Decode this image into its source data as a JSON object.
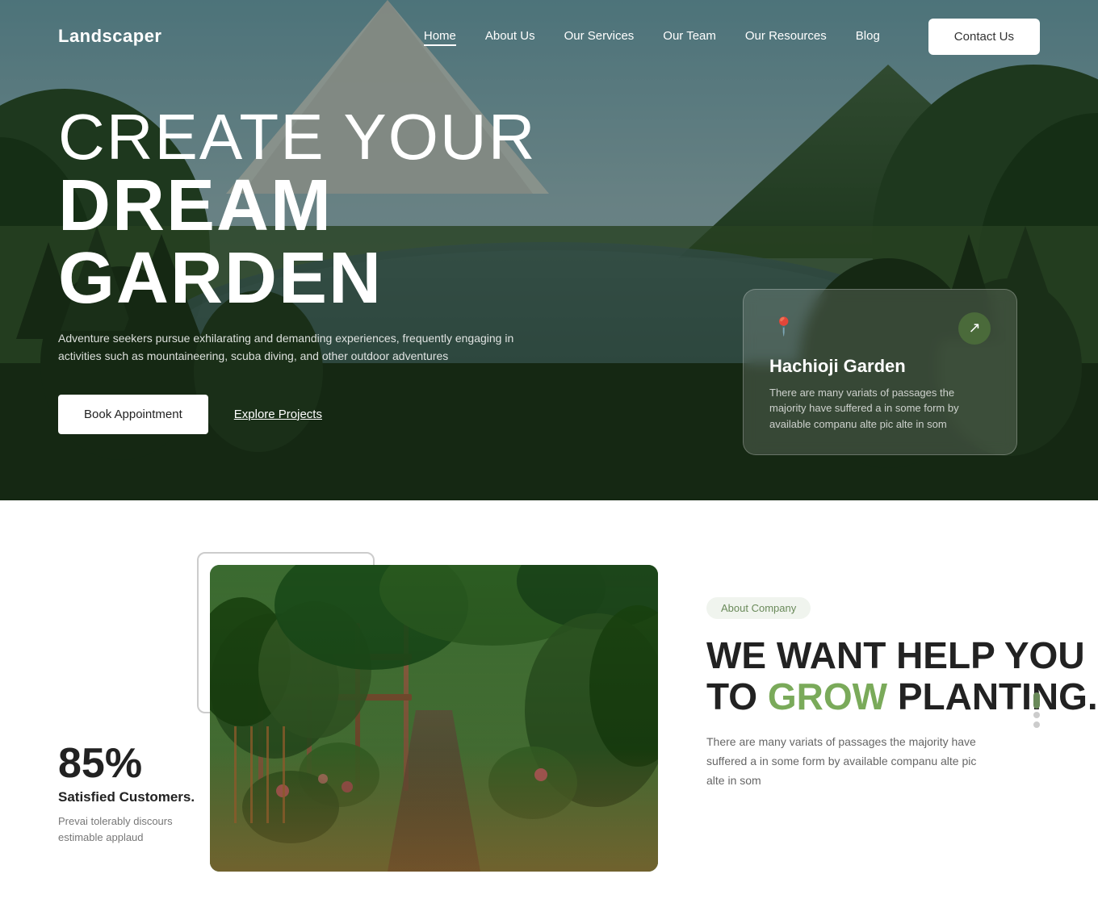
{
  "brand": {
    "logo": "Landscaper"
  },
  "nav": {
    "links": [
      {
        "label": "Home",
        "active": true
      },
      {
        "label": "About Us",
        "active": false
      },
      {
        "label": "Our Services",
        "active": false
      },
      {
        "label": "Our Team",
        "active": false
      },
      {
        "label": "Our Resources",
        "active": false
      },
      {
        "label": "Blog",
        "active": false
      }
    ],
    "contact_button": "Contact Us"
  },
  "hero": {
    "title_line1": "CREATE YOUR",
    "title_line2": "DREAM GARDEN",
    "subtitle": "Adventure seekers pursue exhilarating and demanding experiences, frequently engaging in activities such as mountaineering, scuba diving, and other outdoor adventures",
    "btn_book": "Book Appointment",
    "btn_explore": "Explore Projects",
    "card": {
      "title": "Hachioji Garden",
      "description": "There are many variats of passages the majority have suffered a in some form by available companu alte pic alte in som",
      "location_icon": "📍",
      "arrow_icon": "↗"
    }
  },
  "section2": {
    "stat": {
      "number": "85%",
      "label": "Satisfied Customers.",
      "description": "Prevai tolerably discours estimable applaud"
    },
    "about_badge": "About Company",
    "about_title_line1": "WE WANT HELP YOU",
    "about_title_line2": "TO",
    "about_title_highlight": "GROW",
    "about_title_line3": "PLANTING.",
    "about_description": "There are many variats of passages the majority have suffered a in some form by available companu alte pic alte in som"
  }
}
